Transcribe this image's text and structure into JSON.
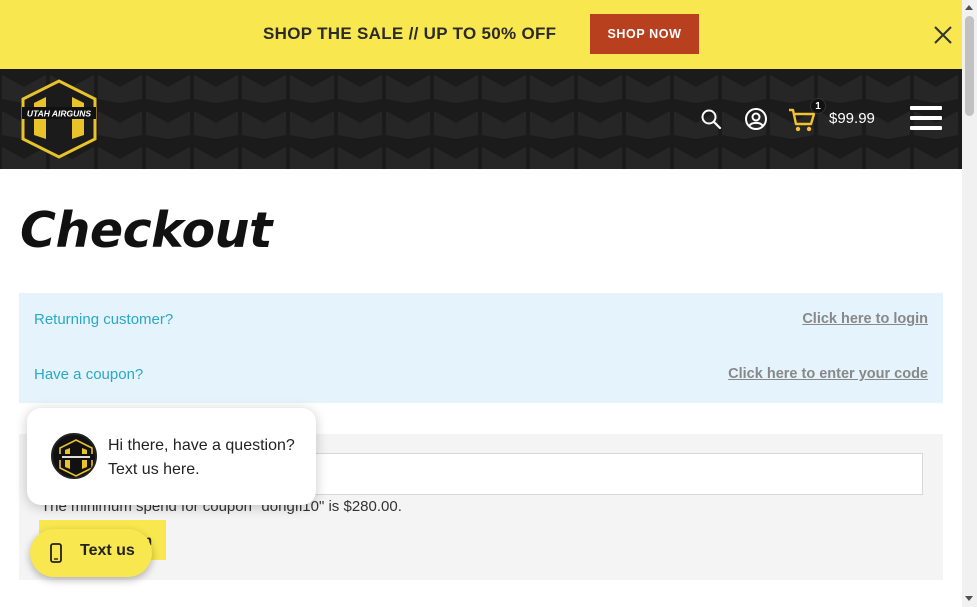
{
  "promo": {
    "text": "SHOP THE SALE // UP TO 50% OFF",
    "button_label": "SHOP NOW"
  },
  "header": {
    "logo_text": "UTAH AIRGUNS",
    "cart_count": "1",
    "cart_total": "$99.99"
  },
  "page": {
    "title": "Checkout"
  },
  "notices": {
    "returning_label": "Returning customer?",
    "login_link": "Click here to login",
    "coupon_label": "Have a coupon?",
    "coupon_link": "Click here to enter your code"
  },
  "coupon": {
    "input_value": "",
    "error_text": "The minimum spend for coupon \"dongfl10\" is $280.00.",
    "apply_label": "Apply coupon"
  },
  "chat": {
    "message": "Hi there, have a question? Text us here.",
    "button_label": "Text us"
  },
  "colors": {
    "promo_bg": "#f8e74e",
    "shop_button": "#b9401f",
    "header_bg": "#1b1b1b",
    "notice_bg": "#e5f3fc",
    "notice_text": "#2aa8c6",
    "brand_yellow": "#f8e74e"
  }
}
